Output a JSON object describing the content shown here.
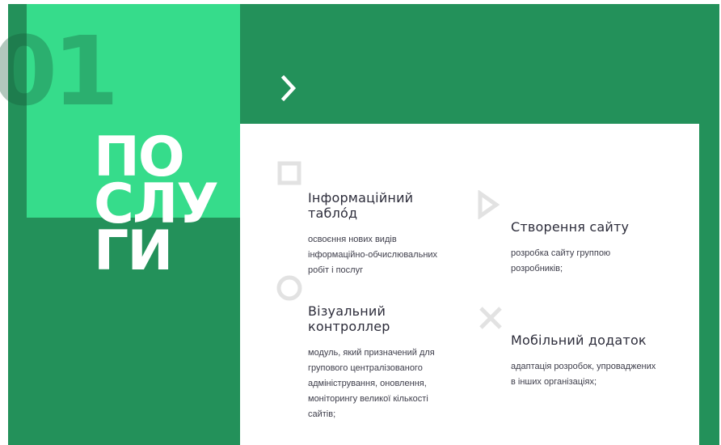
{
  "hero": {
    "number": "01",
    "title_lines": [
      "ПО",
      "СЛУ",
      "ГИ"
    ]
  },
  "nav": {
    "next_icon": "chevron-right-icon"
  },
  "services": [
    {
      "title": "Інформаційний табло́д",
      "description": "освоєння нових видів інформаційно-обчислювальних робіт і послуг",
      "icon": "square-outline-icon"
    },
    {
      "title": "Створення сайту",
      "description": "розробка сайту группою розробників;",
      "icon": "triangle-play-icon"
    },
    {
      "title": "Візуальний контроллер",
      "description": "модуль, який призначений для групового централізованого адміністрування, оновлення, моніторингу великої кількості сайтів;",
      "icon": "circle-outline-icon"
    },
    {
      "title": "Мобільний додаток",
      "description": "адаптація розробок, упроваджених в інших організаціях;",
      "icon": "cross-x-icon"
    }
  ],
  "colors": {
    "background_green": "#23915a",
    "accent_green": "#36dc8b",
    "icon_gray": "#e2e2e2",
    "text_dark": "#2c2c3a"
  }
}
